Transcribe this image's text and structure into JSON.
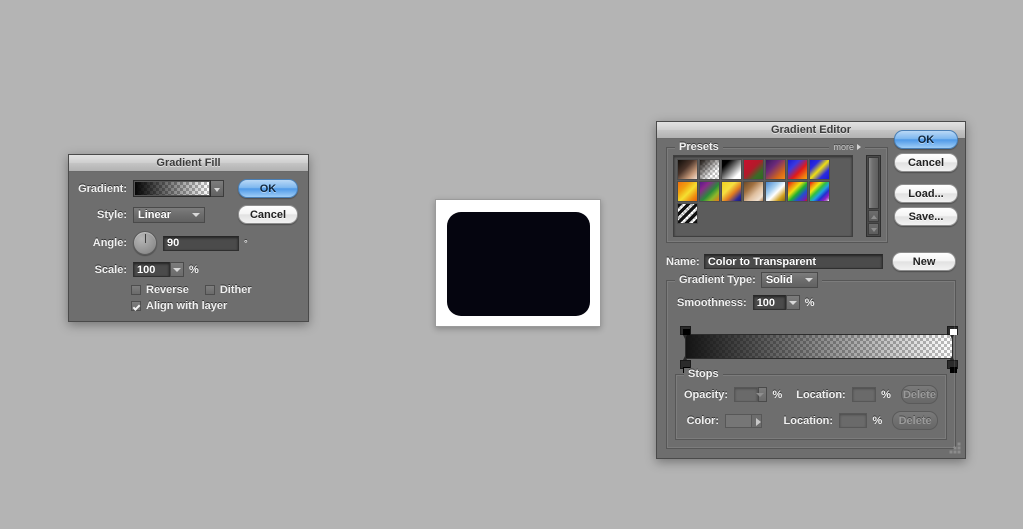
{
  "desktop": {
    "background": "#b4b4b4"
  },
  "gradient_fill": {
    "title": "Gradient Fill",
    "rows": {
      "gradient_label": "Gradient:",
      "style_label": "Style:",
      "style_value": "Linear",
      "angle_label": "Angle:",
      "angle_value": "90",
      "angle_unit": "°",
      "scale_label": "Scale:",
      "scale_value": "100",
      "scale_unit": "%"
    },
    "checkboxes": [
      {
        "label": "Reverse",
        "checked": false
      },
      {
        "label": "Dither",
        "checked": false
      },
      {
        "label": "Align with layer",
        "checked": true
      }
    ],
    "buttons": {
      "ok": "OK",
      "cancel": "Cancel"
    },
    "gradient_preview": {
      "from": "#000000",
      "to": "transparent",
      "description": "black-to-transparent"
    }
  },
  "document_window": {
    "canvas_fill": "#05050f",
    "paper": "#ffffff"
  },
  "gradient_editor": {
    "title": "Gradient Editor",
    "presets": {
      "group_label": "Presets",
      "more_label": "more",
      "swatches": [
        {
          "name": "foreground-to-background",
          "css": "linear-gradient(135deg, #100c08 0%, #4a342a 40%, #c79a7a 75%, #f1ddcf 100%)"
        },
        {
          "name": "foreground-to-transparent",
          "css": "checker-dark"
        },
        {
          "name": "black-white",
          "css": "linear-gradient(135deg, #000000 0%, #000000 20%, #ffffff 80%, #ffffff 100%)"
        },
        {
          "name": "red-green",
          "css": "linear-gradient(135deg, #c8102e 0%, #b21a2a 45%, #3a6b28 75%, #2f6b1f 100%)"
        },
        {
          "name": "violet-orange",
          "css": "linear-gradient(135deg, #3a1a5e 0%, #6b2a7a 35%, #d4661a 75%, #f08a1a 100%)"
        },
        {
          "name": "blue-red-yellow",
          "css": "linear-gradient(135deg, #1a1ad4 0%, #3a3ae0 30%, #e01a1a 60%, #f07a10 85%, #f0a010 100%)"
        },
        {
          "name": "blue-yellow-blue",
          "css": "linear-gradient(135deg, #1a1ad4 0%, #2a2ae0 25%, #f0e010 50%, #2a2ae0 75%, #1a1ad4 100%)"
        },
        {
          "name": "orange-yellow-orange",
          "css": "linear-gradient(135deg, #f07010 0%, #f0a010 30%, #f5e030 55%, #f09010 80%, #e8600a 100%)"
        },
        {
          "name": "violet-green-orange",
          "css": "linear-gradient(135deg, #5a1a8a 0%, #8a2a8a 25%, #2a8a3a 55%, #8ab82a 75%, #e8741a 100%)"
        },
        {
          "name": "yellow-violet-orange-blue",
          "css": "linear-gradient(135deg, #f0d020 0%, #f5e040 35%, #e07a20 60%, #2a2a9a 85%, #1a1a7a 100%)"
        },
        {
          "name": "copper",
          "css": "linear-gradient(135deg, #6b4a2a 0%, #a07040 30%, #e0c0a0 60%, #f0e0d0 85%, #b08050 100%)"
        },
        {
          "name": "chrome",
          "css": "linear-gradient(135deg, #4a88d0 0%, #a8d0f0 35%, #ffffff 55%, #d0a020 80%, #8a6a10 100%)"
        },
        {
          "name": "spectrum",
          "css": "linear-gradient(135deg, #e01010 0%, #f08010 18%, #f0e010 36%, #20b030 54%, #2050d0 72%, #7020b0 90%, #e01010 100%)"
        },
        {
          "name": "transparent-rainbow",
          "css": "rainbow-checker"
        },
        {
          "name": "transparent-stripes",
          "css": "stripes-checker"
        }
      ]
    },
    "buttons": {
      "ok": "OK",
      "cancel": "Cancel",
      "load": "Load...",
      "save": "Save...",
      "new": "New"
    },
    "name_row": {
      "label": "Name:",
      "value": "Color to Transparent"
    },
    "gradient_type": {
      "label": "Gradient Type:",
      "value": "Solid"
    },
    "smoothness": {
      "label": "Smoothness:",
      "value": "100",
      "unit": "%"
    },
    "gradient_strip": {
      "from_color": "#1a1a1a",
      "to_color": "transparent",
      "stops_top": [
        {
          "position_pct": 0,
          "opacity_pct": 100,
          "chip": "#000000"
        },
        {
          "position_pct": 100,
          "opacity_pct": 0,
          "chip": "#ffffff"
        }
      ],
      "stops_bottom": [
        {
          "position_pct": 0,
          "chip": "#000000"
        },
        {
          "position_pct": 100,
          "chip": "#000000"
        }
      ]
    },
    "stops": {
      "group_label": "Stops",
      "opacity_label": "Opacity:",
      "opacity_value": "",
      "opacity_unit": "%",
      "opacity_location_label": "Location:",
      "opacity_location_value": "",
      "opacity_location_unit": "%",
      "opacity_delete_label": "Delete",
      "color_label": "Color:",
      "color_value": "",
      "color_location_label": "Location:",
      "color_location_value": "",
      "color_location_unit": "%",
      "color_delete_label": "Delete"
    }
  }
}
